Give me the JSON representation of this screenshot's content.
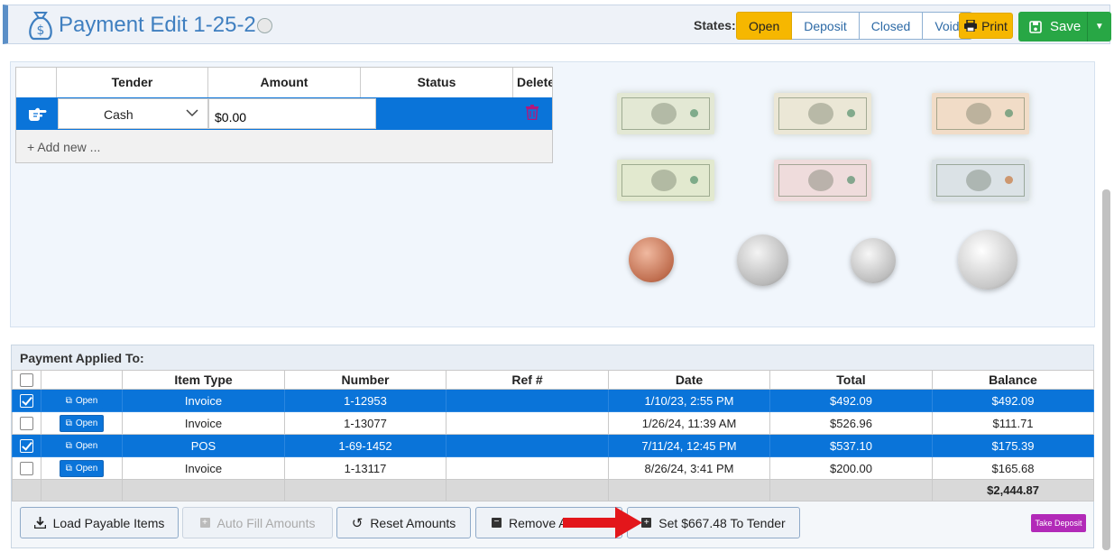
{
  "header": {
    "title": "Payment Edit 1-25-2",
    "states_label": "States:",
    "states": [
      "Open",
      "Deposit",
      "Closed",
      "Void"
    ],
    "active_state": "Open",
    "print_label": "Print",
    "save_label": "Save"
  },
  "tender": {
    "columns": [
      "Tender",
      "Amount",
      "Status",
      "Delete"
    ],
    "row": {
      "tender": "Cash",
      "amount": "$0.00",
      "status": ""
    },
    "add_new": "Add new ..."
  },
  "money": {
    "bills": [
      "one-dollar-bill",
      "five-dollar-bill",
      "ten-dollar-bill",
      "twenty-dollar-bill",
      "fifty-dollar-bill",
      "hundred-dollar-bill"
    ],
    "coins": [
      "penny",
      "nickel",
      "dime",
      "quarter"
    ]
  },
  "applied": {
    "title": "Payment Applied To:",
    "columns": [
      "",
      "",
      "Item Type",
      "Number",
      "Ref #",
      "Date",
      "Total",
      "Balance"
    ],
    "open_label": "Open",
    "rows": [
      {
        "checked": true,
        "type": "Invoice",
        "number": "1-12953",
        "ref": "",
        "date": "1/10/23, 2:55 PM",
        "total": "$492.09",
        "balance": "$492.09"
      },
      {
        "checked": false,
        "type": "Invoice",
        "number": "1-13077",
        "ref": "",
        "date": "1/26/24, 11:39 AM",
        "total": "$526.96",
        "balance": "$111.71"
      },
      {
        "checked": true,
        "type": "POS",
        "number": "1-69-1452",
        "ref": "",
        "date": "7/11/24, 12:45 PM",
        "total": "$537.10",
        "balance": "$175.39"
      },
      {
        "checked": false,
        "type": "Invoice",
        "number": "1-13117",
        "ref": "",
        "date": "8/26/24, 3:41 PM",
        "total": "$200.00",
        "balance": "$165.68"
      }
    ],
    "balance_total": "$2,444.87"
  },
  "buttons": {
    "load_payable": "Load Payable Items",
    "auto_fill": "Auto Fill Amounts",
    "reset": "Reset Amounts",
    "remove": "Remove A",
    "set_tender": "Set $667.48 To Tender",
    "take_deposit": "Take Deposit"
  },
  "colors": {
    "accent": "#0a74d9",
    "open_state": "#f6b700",
    "save": "#28a745",
    "take_deposit": "#b22ab8"
  }
}
